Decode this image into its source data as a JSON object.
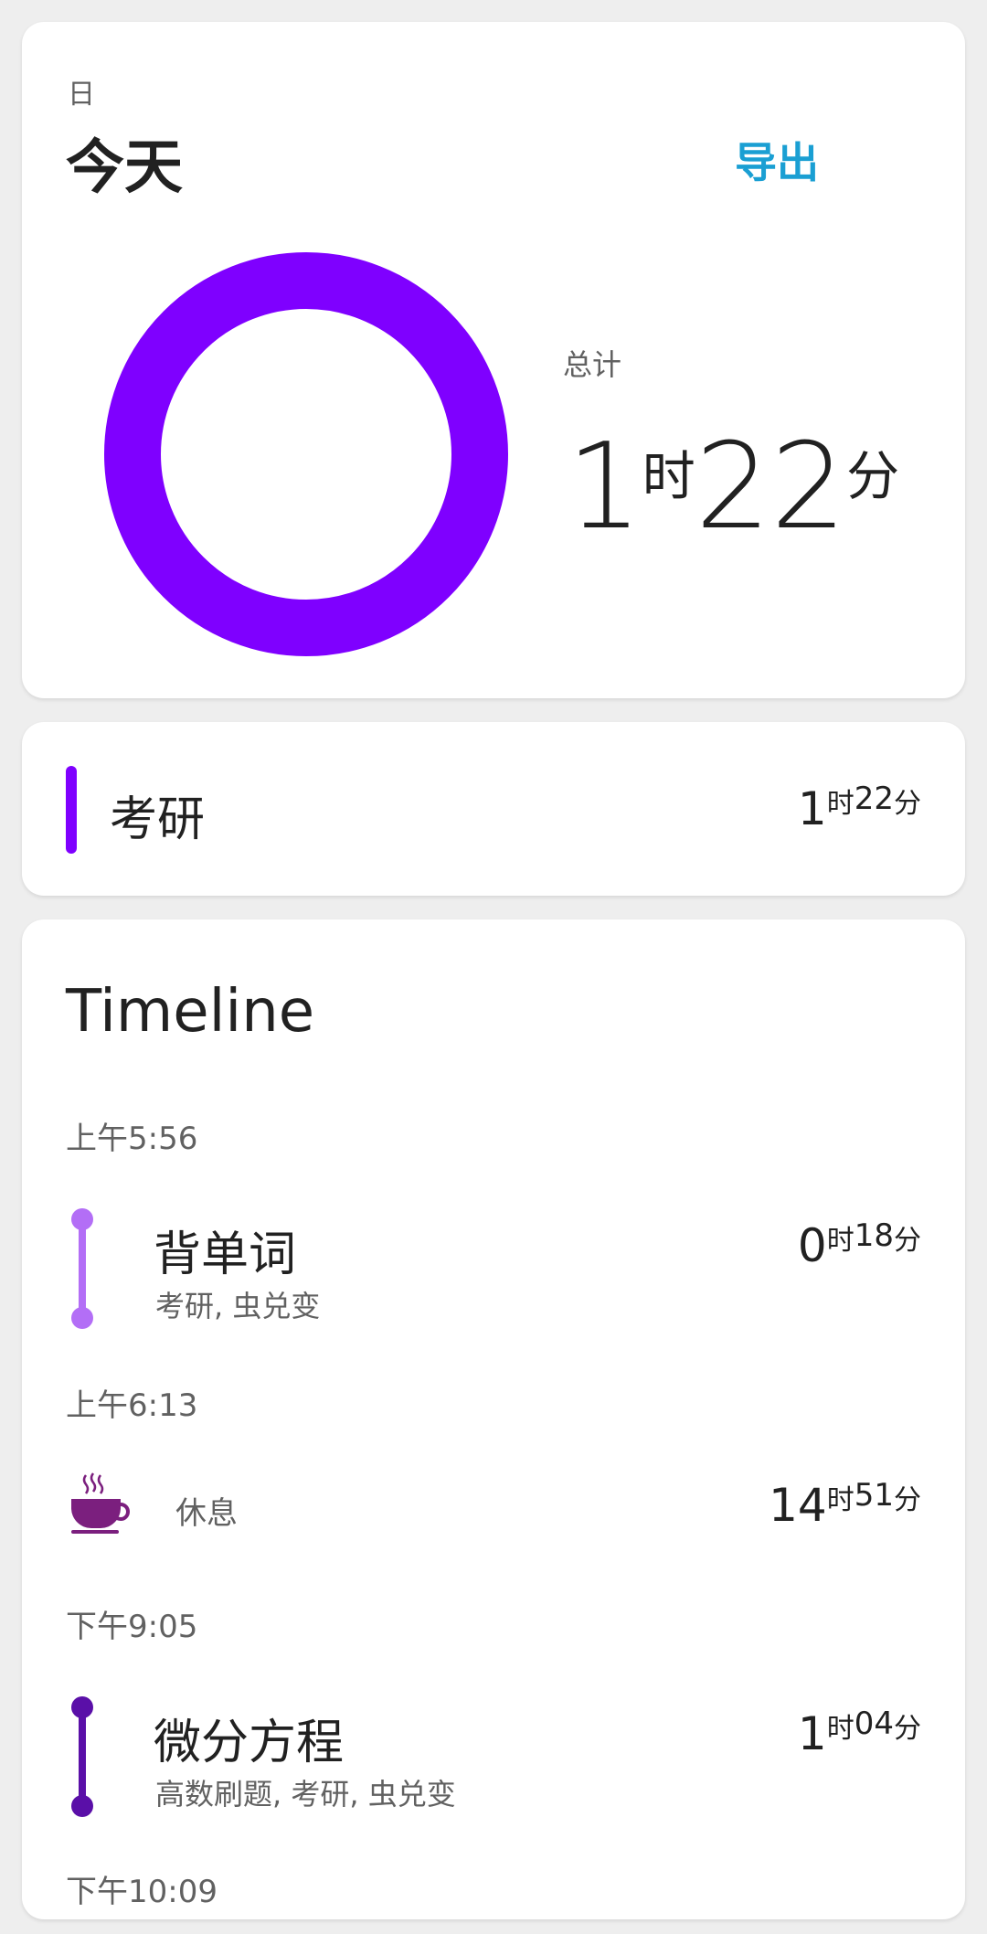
{
  "summary": {
    "period_label": "日",
    "period_title": "今天",
    "export_label": "导出",
    "total_label": "总计",
    "total_hours": "1",
    "hours_unit": "时",
    "total_minutes": "22",
    "minutes_unit": "分",
    "donut_color": "#7f00ff"
  },
  "categories": [
    {
      "name": "考研",
      "hours": "1",
      "minutes": "22",
      "color": "#7f00ff"
    }
  ],
  "timeline": {
    "title": "Timeline",
    "entries": [
      {
        "time": "上午5:56",
        "name": "背单词",
        "tags": "考研, 虫兑变",
        "hours": "0",
        "minutes": "18",
        "color": "#b36ef6"
      },
      {
        "time": "上午6:13",
        "break_label": "休息",
        "hours": "14",
        "minutes": "51",
        "icon": "coffee-cup-icon",
        "color": "#7b1f7e"
      },
      {
        "time": "下午9:05",
        "name": "微分方程",
        "tags": "高数刷题, 考研, 虫兑变",
        "hours": "1",
        "minutes": "04",
        "color": "#5a0fa8"
      },
      {
        "time": "下午10:09"
      }
    ]
  },
  "units": {
    "h": "时",
    "m": "分"
  }
}
